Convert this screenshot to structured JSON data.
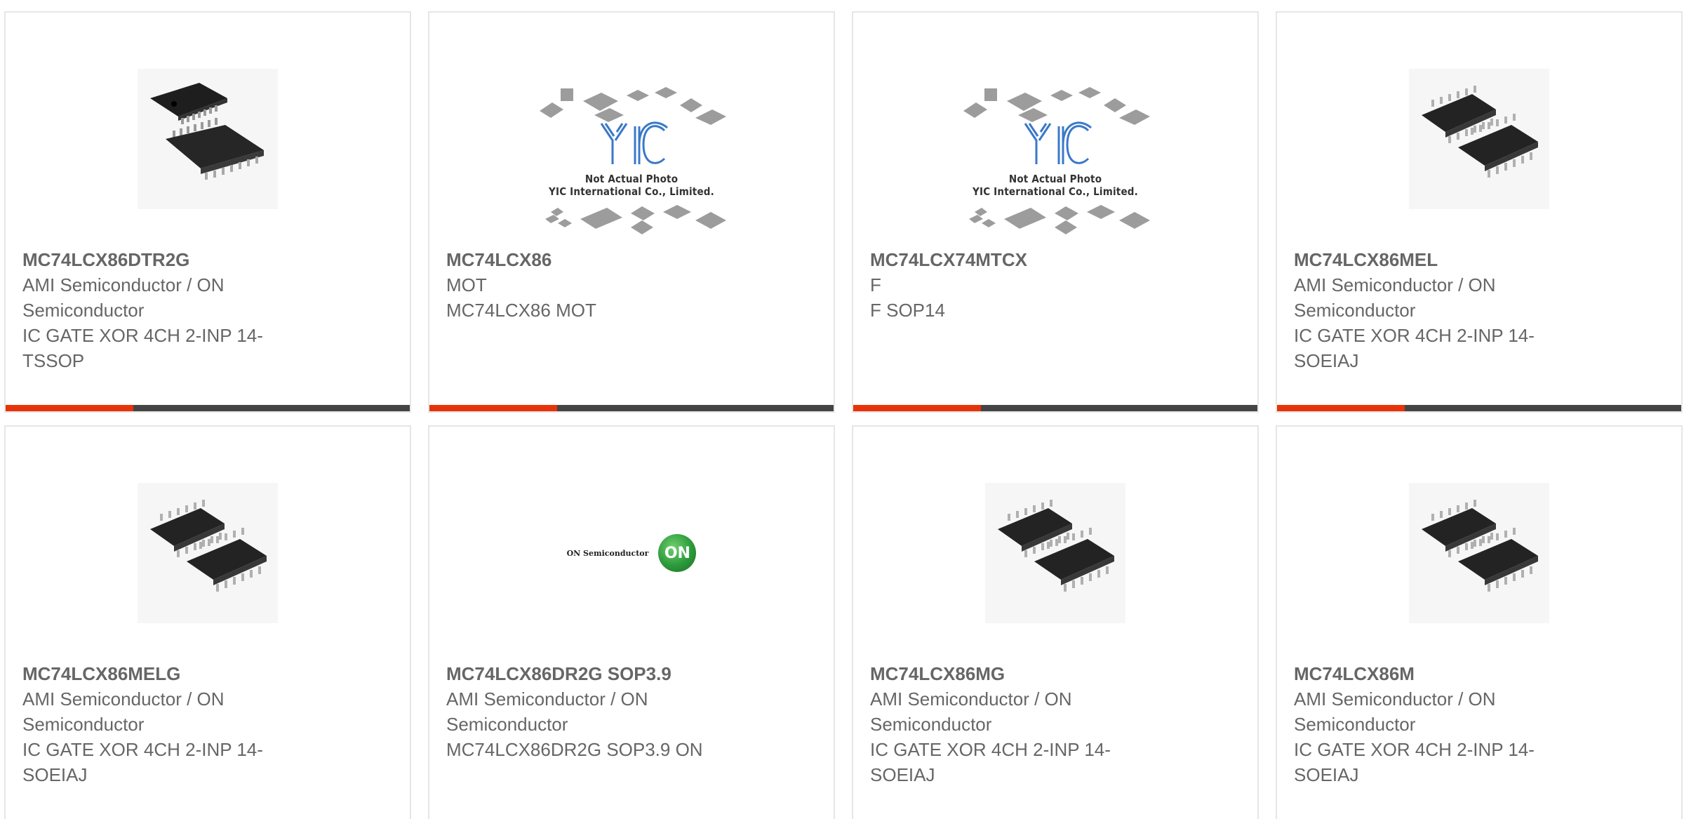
{
  "products": [
    {
      "part_number": "MC74LCX86DTR2G",
      "lines": [
        "AMI Semiconductor / ON",
        "Semiconductor",
        "IC GATE XOR 4CH 2-INP 14-",
        "TSSOP"
      ],
      "image": "tssop-chip-photo"
    },
    {
      "part_number": "MC74LCX86",
      "lines": [
        "MOT",
        "MC74LCX86 MOT"
      ],
      "image": "yic-placeholder",
      "placeholder_caption_1": "Not Actual Photo",
      "placeholder_caption_2": "YIC International Co., Limited."
    },
    {
      "part_number": "MC74LCX74MTCX",
      "lines": [
        "F",
        "F SOP14"
      ],
      "image": "yic-placeholder",
      "placeholder_caption_1": "Not Actual Photo",
      "placeholder_caption_2": "YIC International Co., Limited."
    },
    {
      "part_number": "MC74LCX86MEL",
      "lines": [
        "AMI Semiconductor / ON",
        "Semiconductor",
        "IC GATE XOR 4CH 2-INP 14-",
        "SOEIAJ"
      ],
      "image": "soic-chip-photo"
    },
    {
      "part_number": "MC74LCX86MELG",
      "lines": [
        "AMI Semiconductor / ON",
        "Semiconductor",
        "IC GATE XOR 4CH 2-INP 14-",
        "SOEIAJ"
      ],
      "image": "soic-chip-photo"
    },
    {
      "part_number": "MC74LCX86DR2G SOP3.9",
      "lines": [
        "AMI Semiconductor / ON",
        "Semiconductor",
        "MC74LCX86DR2G SOP3.9 ON"
      ],
      "image": "on-semiconductor-logo",
      "logo_text": "ON Semiconductor",
      "logo_mark": "ON"
    },
    {
      "part_number": "MC74LCX86MG",
      "lines": [
        "AMI Semiconductor / ON",
        "Semiconductor",
        "IC GATE XOR 4CH 2-INP 14-",
        "SOEIAJ"
      ],
      "image": "soic-chip-photo"
    },
    {
      "part_number": "MC74LCX86M",
      "lines": [
        "AMI Semiconductor / ON",
        "Semiconductor",
        "IC GATE XOR 4CH 2-INP 14-",
        "SOEIAJ"
      ],
      "image": "soic-chip-photo"
    }
  ],
  "colors": {
    "accent": "#e8330a",
    "bar": "#444444",
    "text": "#666666",
    "border": "#e6e6e6"
  }
}
